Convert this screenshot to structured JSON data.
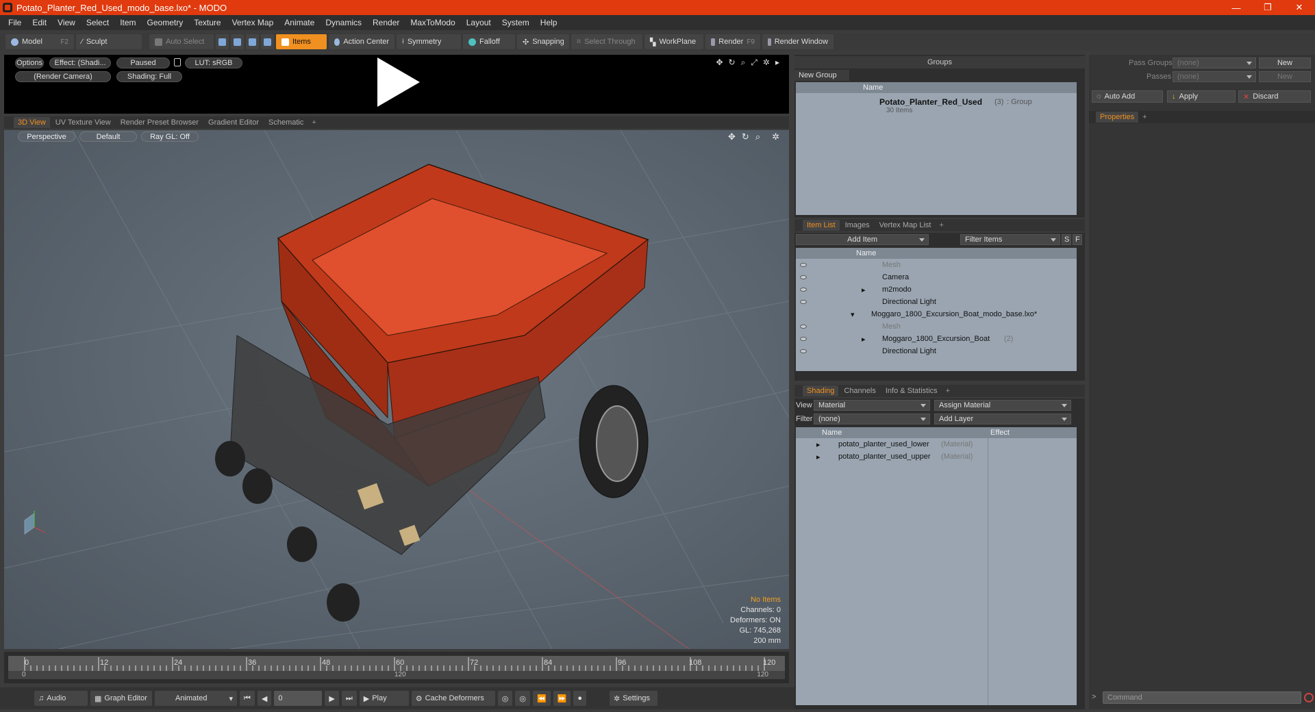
{
  "window": {
    "title": "Potato_Planter_Red_Used_modo_base.lxo* - MODO",
    "controls": [
      "—",
      "❐",
      "✕"
    ]
  },
  "menu": [
    "File",
    "Edit",
    "View",
    "Select",
    "Item",
    "Geometry",
    "Texture",
    "Vertex Map",
    "Animate",
    "Dynamics",
    "Render",
    "MaxToModo",
    "Layout",
    "System",
    "Help"
  ],
  "toolbar": {
    "model": "Model",
    "model_key": "F2",
    "sculpt": "Sculpt",
    "auto_select": "Auto Select",
    "items": "Items",
    "action_center": "Action Center",
    "symmetry": "Symmetry",
    "falloff": "Falloff",
    "snapping": "Snapping",
    "select_through": "Select Through",
    "workplane": "WorkPlane",
    "render": "Render",
    "render_key": "F9",
    "render_window": "Render Window"
  },
  "preview": {
    "options": "Options",
    "effect": "Effect: (Shadi...",
    "paused": "Paused",
    "lut": "LUT: sRGB",
    "camera": "(Render Camera)",
    "shading": "Shading: Full"
  },
  "view_tabs": [
    "3D View",
    "UV Texture View",
    "Render Preset Browser",
    "Gradient Editor",
    "Schematic"
  ],
  "viewport": {
    "perspective": "Perspective",
    "default": "Default",
    "raygl": "Ray GL: Off",
    "no_items": "No Items",
    "channels": "Channels: 0",
    "deformers": "Deformers: ON",
    "gl": "GL: 745,268",
    "scale": "200 mm"
  },
  "timeline": {
    "ticks": [
      "0",
      "12",
      "24",
      "36",
      "48",
      "60",
      "72",
      "84",
      "96",
      "108",
      "120"
    ],
    "start": "0",
    "mid": "120",
    "end": "120"
  },
  "bottom": {
    "audio": "Audio",
    "graph_editor": "Graph Editor",
    "animated": "Animated",
    "frame": "0",
    "play": "Play",
    "cache": "Cache Deformers",
    "settings": "Settings"
  },
  "groups": {
    "title": "Groups",
    "new_group": "New Group",
    "col_name": "Name",
    "item_name": "Potato_Planter_Red_Used",
    "item_count": "(3)",
    "item_type": ": Group",
    "item_sub": "30 Items"
  },
  "item_tabs": [
    "Item List",
    "Images",
    "Vertex Map List"
  ],
  "itemlist": {
    "add_item": "Add Item",
    "filter": "Filter Items",
    "s": "S",
    "f": "F",
    "col_name": "Name",
    "rows": [
      {
        "label": "Mesh",
        "dim": true,
        "indent": 0
      },
      {
        "label": "Camera",
        "dim": false,
        "indent": 0
      },
      {
        "label": "m2modo",
        "dim": false,
        "indent": 0
      },
      {
        "label": "Directional Light",
        "dim": false,
        "indent": 0
      },
      {
        "label": "Moggaro_1800_Excursion_Boat_modo_base.lxo*",
        "dim": false,
        "indent": -1
      },
      {
        "label": "Mesh",
        "dim": true,
        "indent": 0
      },
      {
        "label": "Moggaro_1800_Excursion_Boat",
        "dim": false,
        "indent": 0,
        "suffix": "(2)"
      },
      {
        "label": "Directional Light",
        "dim": false,
        "indent": 0
      }
    ]
  },
  "shading_tabs": [
    "Shading",
    "Channels",
    "Info & Statistics"
  ],
  "shading": {
    "view_label": "View",
    "view_value": "Material",
    "assign": "Assign Material",
    "filter_label": "Filter",
    "filter_value": "(none)",
    "add_layer": "Add Layer",
    "col_name": "Name",
    "col_effect": "Effect",
    "rows": [
      {
        "label": "potato_planter_used_lower",
        "type": "(Material)"
      },
      {
        "label": "potato_planter_used_upper",
        "type": "(Material)"
      }
    ]
  },
  "passes": {
    "pass_groups": "Pass Groups",
    "passes": "Passes",
    "none": "(none)",
    "new": "New",
    "auto_add": "Auto Add",
    "apply": "Apply",
    "discard": "Discard"
  },
  "properties": {
    "tab": "Properties"
  },
  "command": {
    "placeholder": "Command"
  }
}
